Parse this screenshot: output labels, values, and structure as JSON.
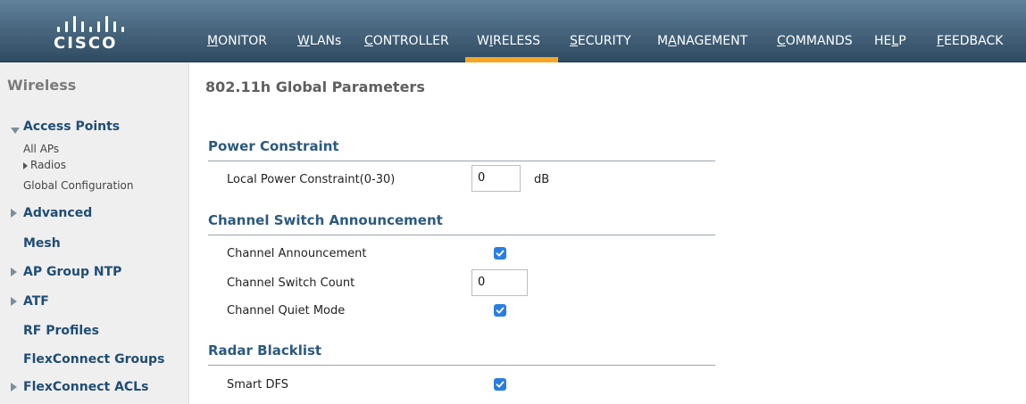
{
  "brand": {
    "name": "CISCO"
  },
  "nav": {
    "items": [
      {
        "label": "MONITOR",
        "ul": "M",
        "rest": "ONITOR"
      },
      {
        "label": "WLANs",
        "ul": "W",
        "rest": "LANs"
      },
      {
        "label": "CONTROLLER",
        "ul": "C",
        "rest": "ONTROLLER"
      },
      {
        "label": "WIRELESS",
        "pre": "W",
        "ul": "I",
        "rest": "RELESS"
      },
      {
        "label": "SECURITY",
        "ul": "S",
        "rest": "ECURITY"
      },
      {
        "label": "MANAGEMENT",
        "pre": "M",
        "ul": "A",
        "rest": "NAGEMENT"
      },
      {
        "label": "COMMANDS",
        "ul": "C",
        "rest": "OMMANDS"
      },
      {
        "label": "HELP",
        "pre": "HE",
        "ul": "L",
        "rest": "P"
      },
      {
        "label": "FEEDBACK",
        "ul": "F",
        "rest": "EEDBACK"
      }
    ],
    "active": "WIRELESS"
  },
  "sidebar": {
    "title": "Wireless",
    "access_points": "Access Points",
    "all_aps": "All APs",
    "radios": "Radios",
    "global_config": "Global Configuration",
    "advanced": "Advanced",
    "mesh": "Mesh",
    "ap_group_ntp": "AP Group NTP",
    "atf": "ATF",
    "rf_profiles": "RF Profiles",
    "flexconnect_groups": "FlexConnect Groups",
    "flexconnect_acls": "FlexConnect ACLs"
  },
  "main": {
    "title": "802.11h Global Parameters",
    "power_constraint": {
      "heading": "Power Constraint",
      "label": "Local Power Constraint(0-30)",
      "value": "0",
      "unit": "dB"
    },
    "csa": {
      "heading": "Channel Switch Announcement",
      "announcement_label": "Channel Announcement",
      "announcement_checked": true,
      "count_label": "Channel Switch Count",
      "count_value": "0",
      "quiet_label": "Channel Quiet Mode",
      "quiet_checked": true
    },
    "radar": {
      "heading": "Radar Blacklist",
      "smart_dfs_label": "Smart DFS",
      "smart_dfs_checked": true
    }
  },
  "colors": {
    "header_top": "#62829b",
    "header_bottom": "#2f4b61",
    "active_tab": "#f6a623",
    "section_heading": "#2c5a80",
    "sidebar_link": "#1f4d74",
    "checkbox": "#2a7de1"
  }
}
